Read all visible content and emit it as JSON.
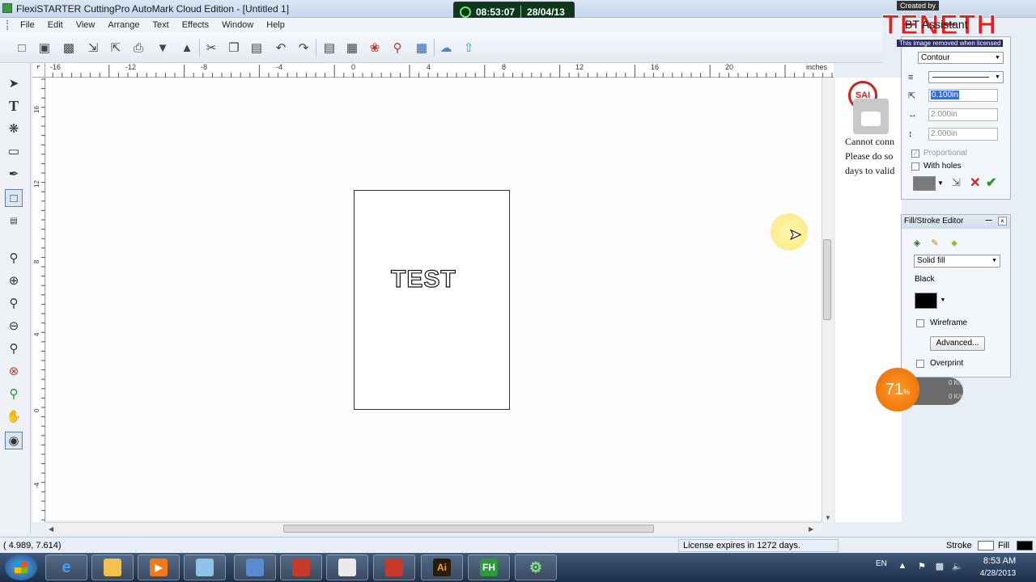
{
  "window": {
    "title": "FlexiSTARTER CuttingPro AutoMark Cloud Edition - [Untitled 1]"
  },
  "clock_overlay": {
    "time": "08:53:07",
    "date": "28/04/13"
  },
  "menu": {
    "items": [
      "File",
      "Edit",
      "View",
      "Arrange",
      "Text",
      "Effects",
      "Window",
      "Help"
    ]
  },
  "toolbar": {
    "icons": [
      "new-icon",
      "open-icon",
      "save-icon",
      "import-icon",
      "export-icon",
      "print-icon",
      "cut-send-icon",
      "production-icon",
      "cut-icon",
      "copy-icon",
      "paste-icon",
      "undo-icon",
      "redo-icon",
      "align-icon",
      "distribute-icon",
      "color-palette-icon",
      "search-icon",
      "color-grid-icon",
      "cloud-icon",
      "cloud-upload-icon"
    ]
  },
  "ruler": {
    "unit": "inches",
    "h_ticks": [
      "-16",
      "-12",
      "-8",
      "-4",
      "0",
      "4",
      "8",
      "12",
      "16",
      "20"
    ],
    "v_ticks": [
      "16",
      "12",
      "8",
      "4",
      "0",
      "-4"
    ]
  },
  "tools": {
    "icons": [
      "select-icon",
      "text-icon",
      "shape-edit-icon",
      "rectangle-icon",
      "pen-icon",
      "contour-icon",
      "measure-icon",
      "zoom-icon",
      "zoom-in-icon",
      "zoom-page-icon",
      "zoom-out-icon",
      "zoom-fit-icon",
      "zoom-selection-icon",
      "zoom-all-icon",
      "pan-icon",
      "fill-stroke-icon"
    ]
  },
  "canvas": {
    "text_object": "TEST"
  },
  "sai_notice": {
    "logo_text": "SAI",
    "line1": "Cannot conn",
    "line2": "Please do so",
    "line3": "days to valid"
  },
  "watermark": {
    "created_by": "Created by",
    "brand": "TENETH",
    "note": "This image removed when licensed",
    "overlap_text": "BT Assistant"
  },
  "contour_panel": {
    "type_value": "Contour",
    "line_style_value": "",
    "offset_value": "0.100in",
    "width_value": "2.000in",
    "height_value": "2.000in",
    "proportional_label": "Proportional",
    "with_holes_label": "With holes"
  },
  "fill_stroke_editor": {
    "title": "Fill/Stroke Editor",
    "fill_type": "Solid fill",
    "color_name": "Black",
    "wireframe_label": "Wireframe",
    "advanced_label": "Advanced...",
    "overprint_label": "Overprint"
  },
  "network_gadget": {
    "percent": "71",
    "percent_sign": "%",
    "upload_rate": "0 K/s",
    "download_rate": "0 K/s"
  },
  "status_bar": {
    "coords": "(   4.989,     7.614)",
    "license": "License expires in 1272 days.",
    "stroke_label": "Stroke",
    "fill_label": "Fill"
  },
  "taskbar": {
    "apps": [
      "ie-icon",
      "explorer-icon",
      "media-player-icon",
      "notepad-icon",
      "remote-desktop-icon",
      "toolbox-icon",
      "window-icon",
      "toolbox2-icon",
      "illustrator-icon",
      "flexi-icon",
      "gear-icon"
    ],
    "illustrator_label": "Ai",
    "flexi_label": "FH",
    "language": "EN",
    "time": "8:53 AM",
    "date": "4/28/2013"
  }
}
